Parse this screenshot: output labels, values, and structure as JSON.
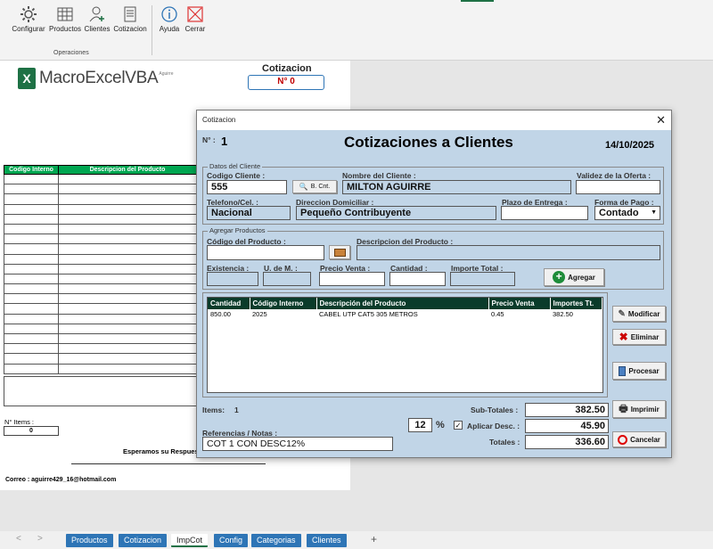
{
  "ribbon": {
    "buttons": [
      {
        "label": "Configurar",
        "icon": "gear-icon"
      },
      {
        "label": "Productos",
        "icon": "grid-icon"
      },
      {
        "label": "Clientes",
        "icon": "add-user-icon"
      },
      {
        "label": "Cotizacion",
        "icon": "document-icon"
      },
      {
        "label": "Ayuda",
        "icon": "info-icon"
      },
      {
        "label": "Cerrar",
        "icon": "close-icon"
      }
    ],
    "group_label": "Operaciones"
  },
  "sheet": {
    "logo_text": "MacroExcelVBA",
    "logo_small": "Aguirre",
    "title": "Cotizacion",
    "number": "N° 0",
    "table_headers": [
      "Codigo Interno",
      "Descripcion del Producto"
    ],
    "items_label": "N° Items :",
    "items_value": "0",
    "esperamos": "Esperamos su Respuesta",
    "correo": "Correo : aguirre429_16@hotmail.com"
  },
  "tabs": [
    "Productos",
    "Cotizacion",
    "ImpCot",
    "Config",
    "Categorias",
    "Clientes"
  ],
  "tab_active": "ImpCot",
  "dialog": {
    "window_title": "Cotizacion",
    "num_label": "N° :",
    "num_value": "1",
    "heading": "Cotizaciones a Clientes",
    "date": "14/10/2025",
    "cliente_frame": "Datos del Cliente",
    "codigo_cliente_label": "Codigo Cliente :",
    "codigo_cliente_value": "555",
    "bcnt_label": "B. Cnt.",
    "nombre_label": "Nombre del Cliente :",
    "nombre_value": "MILTON AGUIRRE",
    "validez_label": "Validez de la Oferta :",
    "validez_value": "",
    "telefono_label": "Telefono/Cel. :",
    "telefono_value": "Nacional",
    "direccion_label": "Direccion Domiciliar :",
    "direccion_value": "Pequeño Contribuyente",
    "plazo_label": "Plazo de Entrega :",
    "plazo_value": "",
    "forma_pago_label": "Forma de Pago :",
    "forma_pago_value": "Contado",
    "productos_frame": "Agregar Productos",
    "codigo_producto_label": "Código del Producto :",
    "descripcion_label": "Descripcion del Producto :",
    "existencia_label": "Existencia :",
    "udem_label": "U. de M. :",
    "precio_venta_label": "Precio Venta :",
    "cantidad_label": "Cantidad :",
    "importe_total_label": "Importe Total :",
    "agregar_label": "Agregar",
    "grid_headers": [
      "Cantidad",
      "Código Interno",
      "Descripción del Producto",
      "Precio Venta",
      "Importes Tt."
    ],
    "grid_rows": [
      [
        "850.00",
        "2025",
        "CABEL UTP CAT5 305 METROS",
        "0.45",
        "382.50"
      ]
    ],
    "modificar_label": "Modificar",
    "eliminar_label": "Eliminar",
    "procesar_label": "Procesar",
    "imprimir_label": "Imprimir",
    "cancelar_label": "Cancelar",
    "items_label": "Items:",
    "items_value": "1",
    "subtotales_label": "Sub-Totales :",
    "subtotales_value": "382.50",
    "desc_value": "12",
    "percent_sign": "%",
    "aplicar_desc_label": "Aplicar Desc. :",
    "aplicar_desc_checked_mark": "✓",
    "desc_amount_value": "45.90",
    "totales_label": "Totales :",
    "totales_value": "336.60",
    "referencias_label": "Referencias  /  Notas :",
    "referencias_value": "COT 1 CON DESC12%"
  }
}
